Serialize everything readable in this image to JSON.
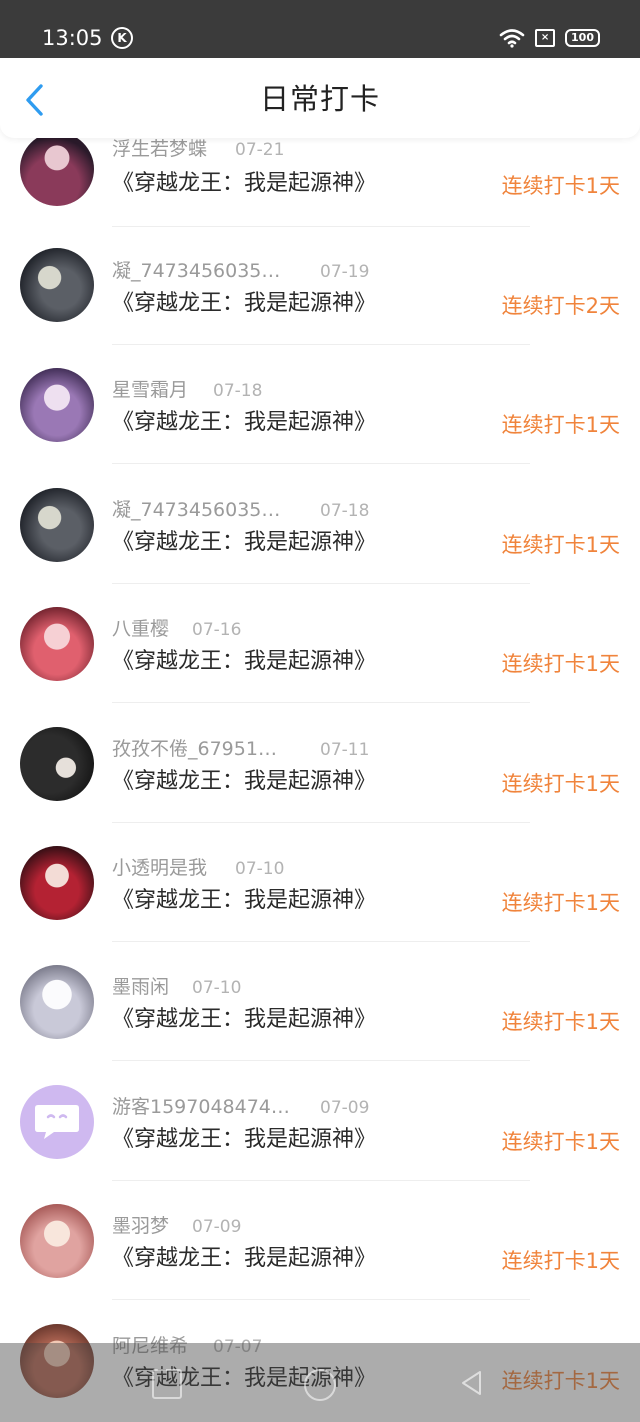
{
  "status_bar": {
    "time": "13:05",
    "k_badge": "K",
    "battery": "100",
    "sim": "×"
  },
  "header": {
    "title": "日常打卡",
    "back_icon": "chevron-left-icon",
    "accent_color": "#2f9cf0"
  },
  "checkins": [
    {
      "user": "浮生若梦蝶",
      "date": "07-21",
      "book": "《穿越龙王：我是起源神》",
      "streak": "连续打卡1天"
    },
    {
      "user": "凝_7473456035…",
      "date": "07-19",
      "book": "《穿越龙王：我是起源神》",
      "streak": "连续打卡2天"
    },
    {
      "user": "星雪霜月",
      "date": "07-18",
      "book": "《穿越龙王：我是起源神》",
      "streak": "连续打卡1天"
    },
    {
      "user": "凝_7473456035…",
      "date": "07-18",
      "book": "《穿越龙王：我是起源神》",
      "streak": "连续打卡1天"
    },
    {
      "user": "八重樱",
      "date": "07-16",
      "book": "《穿越龙王：我是起源神》",
      "streak": "连续打卡1天"
    },
    {
      "user": "孜孜不倦_67951…",
      "date": "07-11",
      "book": "《穿越龙王：我是起源神》",
      "streak": "连续打卡1天"
    },
    {
      "user": "小透明是我",
      "date": "07-10",
      "book": "《穿越龙王：我是起源神》",
      "streak": "连续打卡1天"
    },
    {
      "user": "墨雨闲",
      "date": "07-10",
      "book": "《穿越龙王：我是起源神》",
      "streak": "连续打卡1天"
    },
    {
      "user": "游客1597048474…",
      "date": "07-09",
      "book": "《穿越龙王：我是起源神》",
      "streak": "连续打卡1天"
    },
    {
      "user": "墨羽梦",
      "date": "07-09",
      "book": "《穿越龙王：我是起源神》",
      "streak": "连续打卡1天"
    },
    {
      "user": "阿尼维希",
      "date": "07-07",
      "book": "《穿越龙王：我是起源神》",
      "streak": "连续打卡1天"
    }
  ],
  "colors": {
    "streak": "#f0843c",
    "status_bar": "#3b3b3b"
  }
}
